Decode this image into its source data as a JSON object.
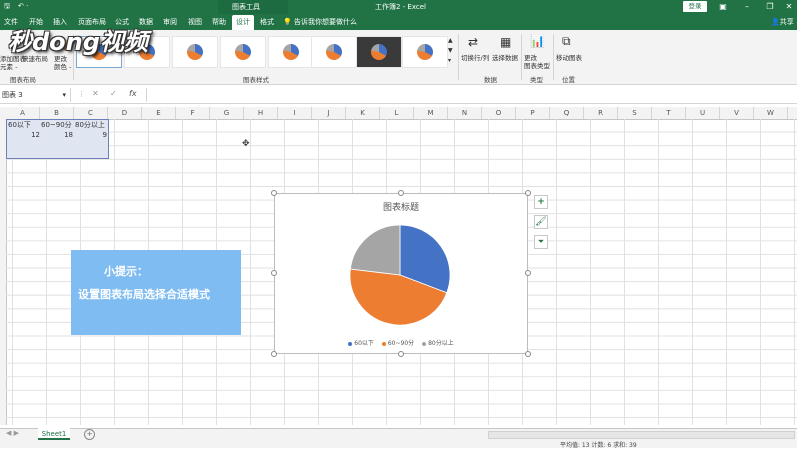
{
  "title_bar": {
    "chart_tools": "图表工具",
    "doc_title": "工作簿2  -  Excel",
    "login": "登录"
  },
  "tabs": [
    "文件",
    "开始",
    "插入",
    "页面布局",
    "公式",
    "数据",
    "审阅",
    "视图",
    "帮助",
    "设计",
    "格式"
  ],
  "active_tab": "设计",
  "tell_me": "告诉我你想要做什么",
  "share": "共享",
  "ribbon": {
    "add_element": "添加图表\n元素 -",
    "quick_layout": "快速布局",
    "change_colors": "更改\n颜色 -",
    "group_layout": "图表布局",
    "group_styles": "图表样式",
    "switch_row_col": "切换行/列",
    "select_data": "选择数据",
    "group_data": "数据",
    "change_type": "更改\n图表类型",
    "group_type": "类型",
    "move_chart": "移动图表",
    "group_location": "位置"
  },
  "watermark": "秒dong视频",
  "name_box": "图表 3",
  "fx": "fx",
  "columns": [
    "A",
    "B",
    "C",
    "D",
    "E",
    "F",
    "G",
    "H",
    "I",
    "J",
    "K",
    "L",
    "M",
    "N",
    "O",
    "P",
    "Q",
    "R",
    "S",
    "T",
    "U",
    "V",
    "W"
  ],
  "cells": {
    "a1": "60以下",
    "b1": "60~90分",
    "c1": "80分以上",
    "a2": "12",
    "b2": "18",
    "c2": "9"
  },
  "tip": {
    "title": "小提示：",
    "body": "设置图表布局选择合适模式"
  },
  "chart_data": {
    "type": "pie",
    "title": "图表标题",
    "categories": [
      "60以下",
      "60~90分",
      "80分以上"
    ],
    "values": [
      12,
      18,
      9
    ],
    "colors": [
      "#4472c4",
      "#ed7d31",
      "#a5a5a5"
    ],
    "legend_position": "bottom"
  },
  "chart_buttons": [
    "+",
    "brush-icon",
    "filter-icon"
  ],
  "sheet_tab": "Sheet1",
  "status": "平均值: 13   计数: 6   求和: 39"
}
